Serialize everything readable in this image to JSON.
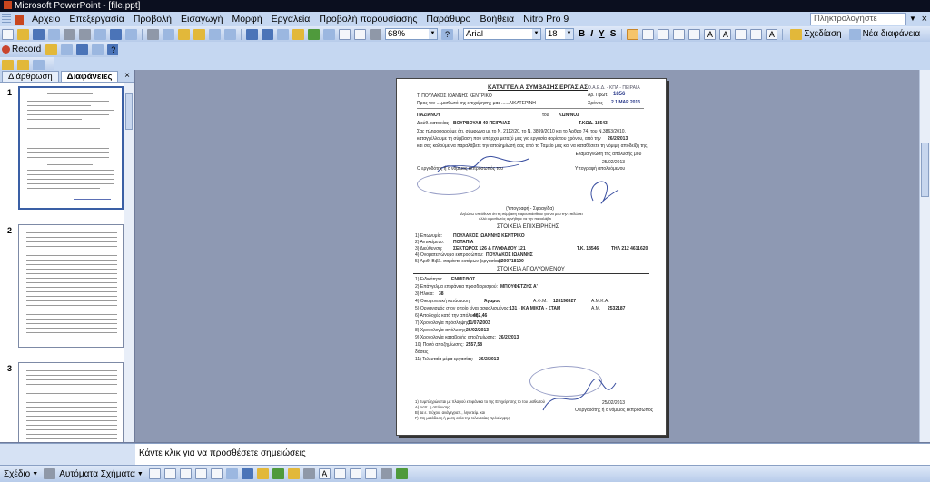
{
  "window": {
    "title": "Microsoft PowerPoint - [file.ppt]"
  },
  "menu": {
    "items": [
      "Αρχείο",
      "Επεξεργασία",
      "Προβολή",
      "Εισαγωγή",
      "Μορφή",
      "Εργαλεία",
      "Προβολή παρουσίασης",
      "Παράθυρο",
      "Βοήθεια",
      "Nitro Pro 9"
    ],
    "help_placeholder": "Πληκτρολογήστε ερώτηση"
  },
  "toolbar": {
    "zoom": "68%",
    "font": "Arial",
    "font_size": "18",
    "bold": "B",
    "italic": "Ι",
    "underline": "Υ",
    "shadow": "S",
    "design_label": "Σχεδίαση",
    "new_slide_label": "Νέα διαφάνεια",
    "record_label": "Record"
  },
  "pane": {
    "tab_outline": "Διάρθρωση",
    "tab_slides": "Διαφάνειες",
    "slide_numbers": [
      "1",
      "2",
      "3"
    ]
  },
  "slide": {
    "heading": "ΚΑΤΑΓΓΕΛΙΑ ΣΥΜΒΑΣΗΣ ΕΡΓΑΣΙΑΣ",
    "org": "Ο.Α.Ε.Δ. - ΚΠΑ - ΠΕΙΡΑΙΑ",
    "ar_prot_label": "Αρ. Πρωτ.",
    "ar_prot_value": "1856",
    "date_label": "Χρόνος",
    "date_value": "2 1 ΜΑΡ 2013",
    "employer_line": "Τ. ΠΟΥΛΑΚΟΣ ΙΩΑΝΝΗΣ ΚΕΝΤΡΙΚΟ",
    "to_line": "Προς τον ....μισθωτό της επιχείρησης μας ......ΑΙΚΑΤΕΡΙΝΗ",
    "name_surname": "ΠΑΖΙΑΝΟΥ",
    "name_of": "του",
    "father": "ΚΩΝ/ΝΟΣ",
    "address_label": "Διεύθ. κατοικίας",
    "address": "ΒΟΥΡΒΟΥΛΗ 40 ΠΕΙΡΑΙΑΣ",
    "tk": "Τ.ΚΩΔ. 18543",
    "body1": "Σας πληροφορούμε ότι, σύμφωνα με το Ν. 2112/20, το Ν. 3899/2010 και το Άρθρο 74, του Ν.3863/2010,",
    "body2": "καταγγέλλουμε τη σύμβαση που υπάρχει μεταξύ μας για εργασία αορίστου χρόνου, από την",
    "body2_date": "26/2/2013",
    "body3": "και σας καλούμε να παραλάβετε την αποζημίωσή σας από το Ταμείο μας και να καταθέσετε τη νόμιμη αποδείξη της.",
    "body4": "Έλαβα γνώση της απόλυσής μου",
    "place_date": "25/02/2013",
    "employer_sig": "Ο εργοδότης ή ο νόμιμος εκπρόσωπός του",
    "employee_sig": "Υπογραφή απολυόμενου",
    "stamp_note": "(Υπογραφή - Σφραγίδα)",
    "witness_note1": "Δηλώνω υπεύθυνα ότι τη σύμβαση παρουσιάσθηκε για να μου την επιδώσει",
    "witness_note2": "αλλά ο μισθωτός αρνήθηκε να την παραλάβει",
    "section1": "ΣΤΟΙΧΕΙΑ ΕΠΙΧΕΙΡΗΣΗΣ",
    "biz_rows": [
      {
        "label": "1) Επωνυμία:",
        "value": "ΠΟΥΛΑΚΟΣ ΙΩΑΝΝΗΣ ΚΕΝΤΡΙΚΟ"
      },
      {
        "label": "2) Αντικείμενο:",
        "value": "ΠΟΤΑΠΙΑ"
      },
      {
        "label": "3) Διεύθυνση:",
        "value": "ΣΕΚΤΩΡΟΣ 126 & ΓΛΥΦΑΔΟΥ  121"
      },
      {
        "label": "4) Ονοματεπώνυμο εκπροσώπου:",
        "value": "ΠΟΥΛΑΚΟΣ ΙΩΑΝΝΗΣ"
      },
      {
        "label": "5) Αριθ. Βιβλ. σαράντα εκτάρων (εργασίας):",
        "value": "8200718100"
      }
    ],
    "biz_tk": "Τ.Κ. 18546",
    "biz_phone": "ΤΗΛ 212 4611620",
    "section2": "ΣΤΟΙΧΕΙΑ ΑΠΟΛΥΟΜΕΝΟΥ",
    "emp_rows": [
      {
        "label": "1) Ειδικότητα:",
        "value": "ΕΝΜΙΣΘΟΣ"
      },
      {
        "label": "2) Επάγγελμα επιφάνεια προσδιορισμού:",
        "value": "ΜΠΟΥΦΕΤΖΗΣ Α'"
      },
      {
        "label": "3) Ηλικία:",
        "value": "38"
      },
      {
        "label": "4) Οικογενειακή κατάσταση:",
        "value": "Άγαμος"
      },
      {
        "label": "5) Οργανισμός στον οποίο είναι ασφαλισμένος:",
        "value": "131 - ΙΚΑ ΜΙΚΤΑ - ΣΤΑΜ"
      },
      {
        "label": "6) Αποδοχές κατά την απόλυση:",
        "value": "462,46"
      },
      {
        "label": "7) Χρονολογία πρόσληψης:",
        "value": "11/07/2003"
      },
      {
        "label": "8) Χρονολογία απόλυσης:",
        "value": "26/02/2013"
      },
      {
        "label": "9) Χρονολογία καταβολής αποζημίωσης:",
        "value": "26/2/2013"
      },
      {
        "label": "10) Ποσό αποζημίωσης:",
        "value": "2557,58"
      },
      {
        "label": "δόσεις",
        "value": ""
      },
      {
        "label": "11) Τελευταία μέρα εργασίας:",
        "value": "26/2/2013"
      }
    ],
    "afm_label": "Α.Φ.Μ.",
    "afm_value": "126196927",
    "amka_label": "Α.Μ.Κ.Α.",
    "am_label": "Α.Μ.",
    "am_value": "2532187",
    "footer1": "1) Συμπληρώνεται με πλαγιού επιφάνεια το της Επιχείρησης το του μισθωτού",
    "footer2": "Α) εισπ. η απόλυσης",
    "footer3": "Β) τα ε. τεύχου, ανάγεγραπ., ληνκτείμ. και",
    "footer4": "Γ) Στη μετάδοση ή μέση αιτία της τελευταίας πρόσληψης",
    "footer_date": "25/02/2013",
    "footer_sig": "Ο εργοδότης ή ο νόμιμος εκπρόσωπος"
  },
  "notes": {
    "placeholder": "Κάντε κλικ για να προσθέσετε σημειώσεις"
  },
  "drawbar": {
    "draw_label": "Σχέδιο",
    "autoshapes_label": "Αυτόματα Σχήματα"
  }
}
